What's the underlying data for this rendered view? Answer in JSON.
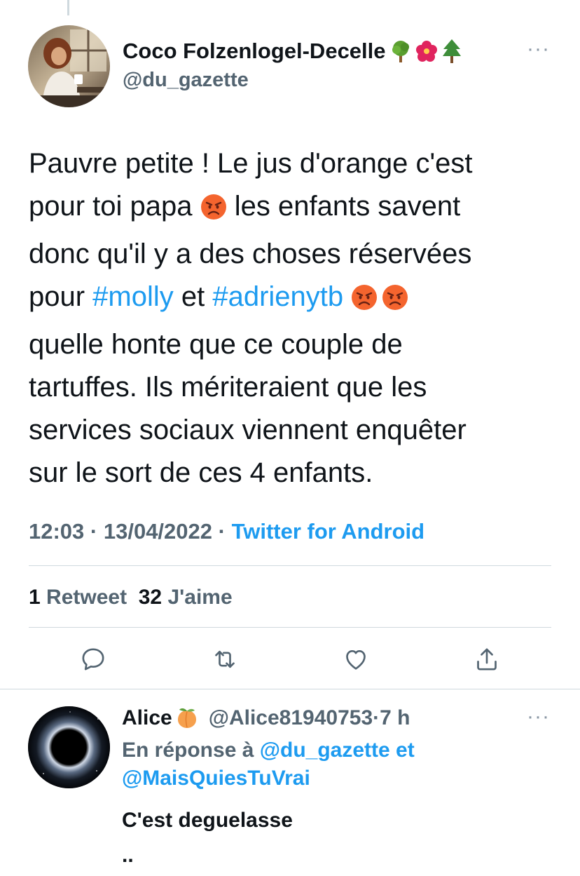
{
  "main_tweet": {
    "author": {
      "display_name": "Coco Folzenlogel-Decelle",
      "handle": "@du_gazette",
      "name_emojis": [
        "tree-emoji",
        "hibiscus-emoji",
        "evergreen-tree-emoji"
      ]
    },
    "more_label": "···",
    "text": {
      "line1": "Pauvre petite ! Le jus d'orange c'est",
      "line2_a": "pour toi papa",
      "line2_b": " les enfants savent",
      "line3": "donc qu'il y a des choses réservées",
      "line4_a": "pour ",
      "line4_hashtag1": "#molly",
      "line4_b": " et ",
      "line4_hashtag2": "#adrienytb",
      "line5": "quelle honte que ce couple de",
      "line6": "tartuffes. Ils mériteraient que les",
      "line7": "services sociaux viennent enquêter",
      "line8": "sur le sort de ces 4 enfants."
    },
    "meta": {
      "time": "12:03",
      "separator": " · ",
      "date": "13/04/2022",
      "source": "Twitter for Android"
    },
    "stats": {
      "retweets_count": "1",
      "retweets_label": "Retweet",
      "likes_count": "32",
      "likes_label": "J'aime"
    },
    "actions": [
      "reply-icon",
      "retweet-icon",
      "like-icon",
      "share-icon"
    ]
  },
  "reply": {
    "display_name": "Alice",
    "name_emoji": "peach-emoji",
    "handle": "@Alice81940753",
    "separator": " · ",
    "time": "7 h",
    "more_label": "···",
    "context_prefix": "En réponse à ",
    "context_mention1": "@du_gazette",
    "context_and": " et",
    "context_mention2": "@MaisQuiesTuVrai",
    "text": "C'est deguelasse",
    "text_continuation": ".."
  },
  "colors": {
    "text": "#0f1419",
    "secondary": "#536471",
    "link": "#1d9bf0",
    "divider": "#cfd9de"
  }
}
